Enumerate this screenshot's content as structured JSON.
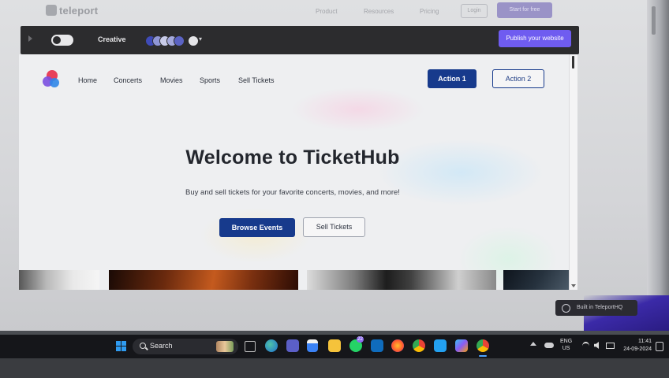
{
  "background_site": {
    "logo": "teleport",
    "nav": [
      "Product",
      "Resources",
      "Pricing"
    ],
    "login": "Login",
    "cta": "Start for free"
  },
  "editor_bar": {
    "mode_label": "Creative",
    "publish_label": "Publish your website",
    "accent_color": "#6f5cf0"
  },
  "site": {
    "nav_links": [
      "Home",
      "Concerts",
      "Movies",
      "Sports",
      "Sell Tickets"
    ],
    "action1": "Action 1",
    "action2": "Action 2",
    "hero_title": "Welcome to TicketHub",
    "hero_subtitle": "Buy and sell tickets for your favorite concerts, movies, and more!",
    "browse_button": "Browse Events",
    "sell_button": "Sell Tickets",
    "primary_color": "#173a8c"
  },
  "badge": {
    "text": "Built in TeleportHQ"
  },
  "taskbar": {
    "search_label": "Search",
    "notification_count": "22",
    "apps": [
      "task-view-icon",
      "edge-icon",
      "teams-icon",
      "store-icon",
      "file-explorer-icon",
      "whatsapp-icon",
      "outlook-icon",
      "firefox-icon",
      "chrome-icon",
      "vscode-icon",
      "copilot-icon",
      "chrome-profile-icon"
    ],
    "lang_line1": "ENG",
    "lang_line2": "US",
    "time": "11:41",
    "date": "24-09-2024"
  }
}
